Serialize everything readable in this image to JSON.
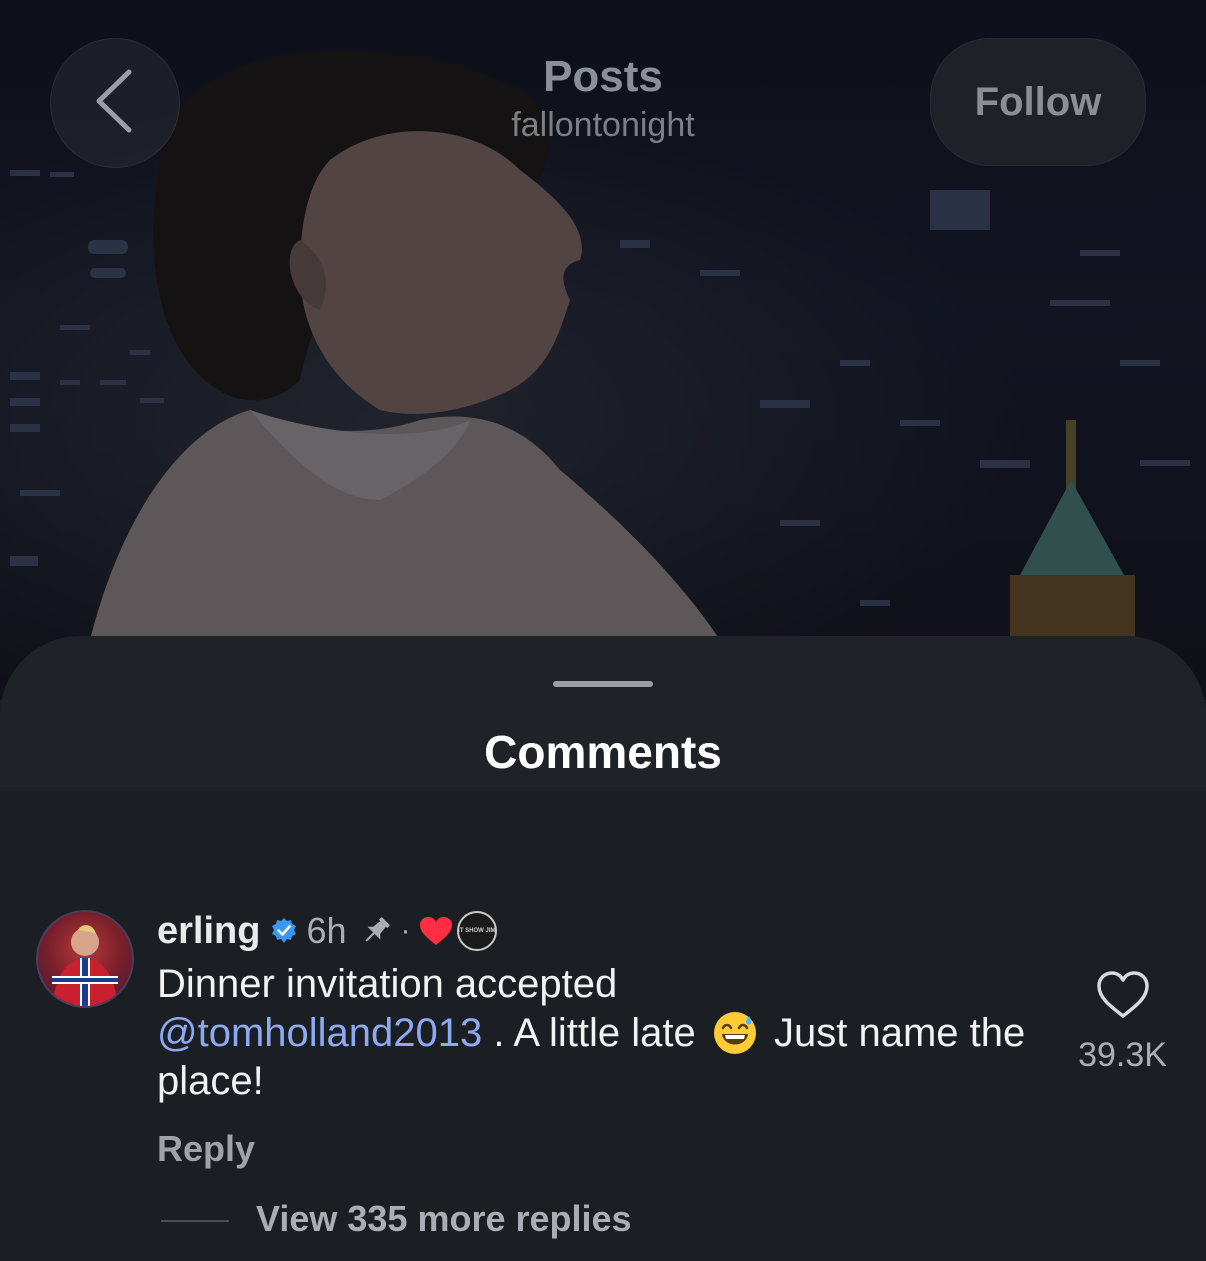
{
  "header": {
    "title": "Posts",
    "subtitle": "fallontonight",
    "follow_label": "Follow"
  },
  "sheet": {
    "title": "Comments"
  },
  "comment": {
    "username": "erling",
    "verified": true,
    "time": "6h",
    "pinned": true,
    "separator": "·",
    "liked_by_creator": true,
    "creator_badge_text": "THE TONIGHT SHOW JIMMY FALLON",
    "text_line1": "Dinner invitation accepted",
    "mention": "@tomholland2013",
    "text_after_mention": ". A little late",
    "emoji": "grinning-face-with-sweat",
    "text_after_emoji": "Just name the place!",
    "reply_label": "Reply",
    "like_count": "39.3K",
    "view_replies_label": "View 335 more replies"
  },
  "colors": {
    "sheet_bg": "#1b1e22",
    "mention": "#8ea9f3",
    "heart_red": "#ff2e45",
    "verified_blue": "#3897f0"
  },
  "icons": {
    "back": "chevron-left-icon",
    "verified": "verified-badge-icon",
    "pin": "pin-icon",
    "creator_like": "red-heart-icon",
    "like": "heart-outline-icon"
  }
}
